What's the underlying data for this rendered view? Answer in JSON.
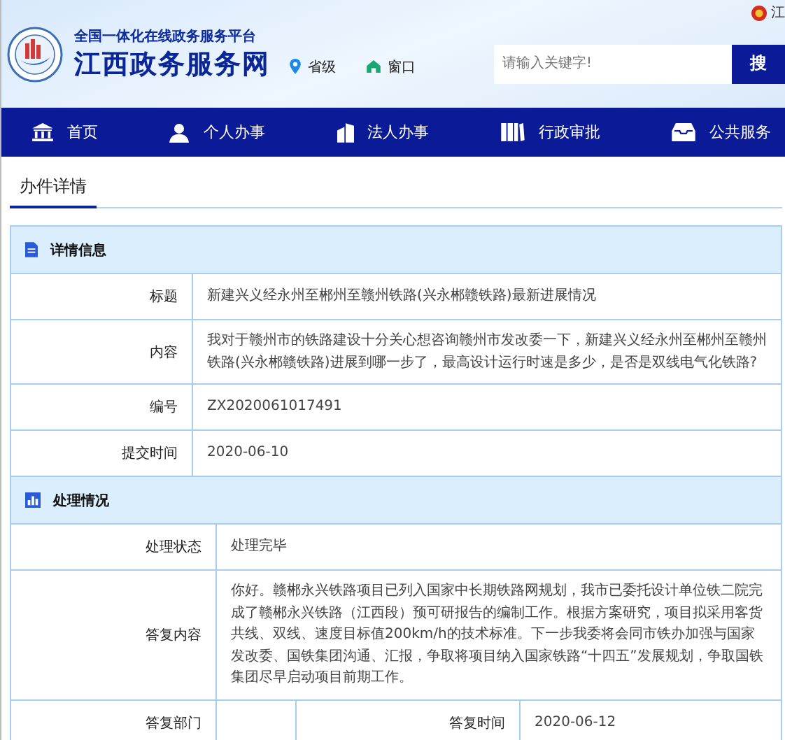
{
  "header": {
    "subtitle": "全国一体化在线政务服务平台",
    "title": "江西政务服务网",
    "region_link": "省级",
    "window_link": "窗口",
    "search": {
      "placeholder": "请输入关键字!",
      "button": "搜"
    },
    "corner_text": "江"
  },
  "nav": [
    {
      "label": "首页"
    },
    {
      "label": "个人办事"
    },
    {
      "label": "法人办事"
    },
    {
      "label": "行政审批"
    },
    {
      "label": "公共服务"
    }
  ],
  "tab": {
    "label": "办件详情",
    "selected": true
  },
  "details": {
    "heading": "详情信息",
    "rows": [
      {
        "label": "标题",
        "value": "新建兴义经永州至郴州至赣州铁路(兴永郴赣铁路)最新进展情况"
      },
      {
        "label": "内容",
        "value": "我对于赣州市的铁路建设十分关心想咨询赣州市发改委一下，新建兴义经永州至郴州至赣州铁路(兴永郴赣铁路)进展到哪一步了，最高设计运行时速是多少，是否是双线电气化铁路?"
      },
      {
        "label": "编号",
        "value": "ZX2020061017491"
      },
      {
        "label": "提交时间",
        "value": "2020-06-10"
      }
    ]
  },
  "handling": {
    "heading": "处理情况",
    "rows": [
      {
        "label": "处理状态",
        "value": "处理完毕"
      },
      {
        "label": "答复内容",
        "value": "你好。赣郴永兴铁路项目已列入国家中长期铁路网规划，我市已委托设计单位铁二院完成了赣郴永兴铁路（江西段）预可研报告的编制工作。根据方案研究，项目拟采用客货共线、双线、速度目标值200km/h的技术标准。下一步我委将会同市铁办加强与国家发改委、国铁集团沟通、汇报，争取将项目纳入国家铁路“十四五”发展规划，争取国铁集团尽早启动项目前期工作。"
      }
    ],
    "reply_department_label": "答复部门",
    "reply_time_label": "答复时间",
    "reply_time": "2020-06-12"
  }
}
